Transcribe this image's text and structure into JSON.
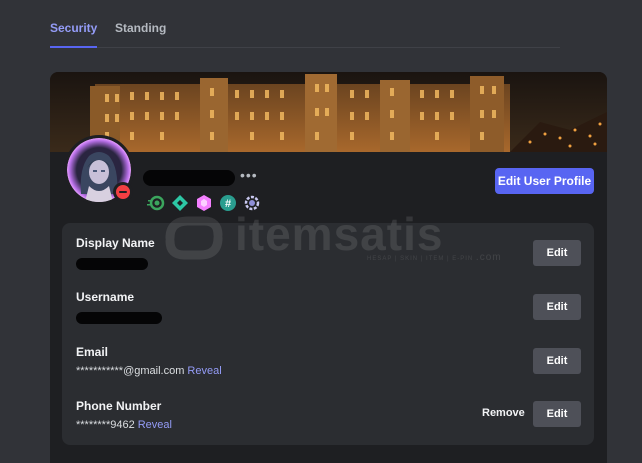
{
  "tabs": [
    {
      "label": "Security",
      "active": true
    },
    {
      "label": "Standing",
      "active": false
    }
  ],
  "profile": {
    "edit_profile_label": "Edit User Profile",
    "more_label": "•••",
    "status": "do-not-disturb",
    "badges": [
      "nitro-icon",
      "boost-icon",
      "hypesquad-icon",
      "hashtag-icon",
      "quest-icon"
    ]
  },
  "fields": [
    {
      "label": "Display Name",
      "value": "",
      "edit_label": "Edit"
    },
    {
      "label": "Username",
      "value": "",
      "edit_label": "Edit"
    },
    {
      "label": "Email",
      "value": "***********@gmail.com",
      "reveal_label": "Reveal",
      "edit_label": "Edit"
    },
    {
      "label": "Phone Number",
      "value": "********9462",
      "reveal_label": "Reveal",
      "edit_label": "Edit",
      "remove_label": "Remove"
    }
  ],
  "watermark": {
    "text": "itemsatis",
    "subtext": "HESAP | SKIN | ITEM | E-PIN",
    "domain": ".com"
  },
  "colors": {
    "accent": "#5865f2",
    "link": "#949cf7",
    "status_dnd": "#f23f43",
    "card_bg": "#1e1f22",
    "panel_bg": "#2b2d31"
  }
}
